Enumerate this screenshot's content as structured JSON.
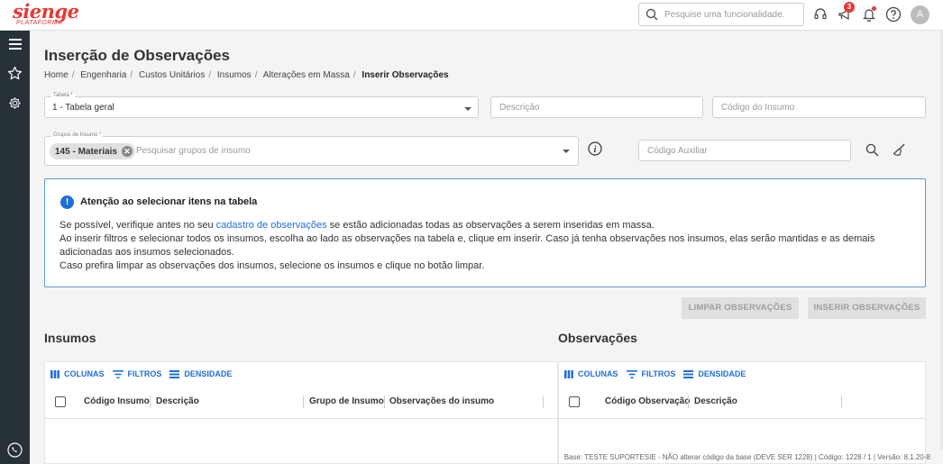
{
  "brand": {
    "name": "sienge",
    "sub": "PLATAFORMA",
    "color": "#e53935"
  },
  "header": {
    "search_placeholder": "Pesquise uma funcionalidade.",
    "notification_count": "3",
    "avatar_letter": "A",
    "icons": [
      "search-icon",
      "headset-icon",
      "megaphone-icon",
      "bell-icon",
      "help-icon"
    ]
  },
  "sidebar": {
    "icons": [
      "menu-icon",
      "star-icon",
      "gear-icon",
      "phone-icon"
    ]
  },
  "page": {
    "title": "Inserção de Observações",
    "breadcrumb": [
      "Home",
      "Engenharia",
      "Custos Unitários",
      "Insumos",
      "Alterações em Massa",
      "Inserir Observações"
    ]
  },
  "filters": {
    "tabela_label": "Tabela *",
    "tabela_value": "1 - Tabela geral",
    "descricao_placeholder": "Descrição",
    "codigo_insumo_placeholder": "Código do Insumo",
    "grupos_label": "Grupos de Insumo *",
    "grupos_chip": "145 - Materiais",
    "grupos_placeholder": "Pesquisar grupos de insumo",
    "codigo_auxiliar_placeholder": "Código Auxiliar"
  },
  "alert": {
    "title": "Atenção ao selecionar itens na tabela",
    "line1_before": "Se possível, verifique antes no seu ",
    "line1_link": "cadastro de observações",
    "line1_after": " se estão adicionadas todas as observações a serem inseridas em massa.",
    "line2": "Ao inserir filtros e selecionar todos os insumos, escolha ao lado as observações na tabela e, clique em inserir. Caso já tenha observações nos insumos, elas serão mantidas e as demais adicionadas aos insumos selecionados.",
    "line3": "Caso prefira limpar as observações dos insumos, selecione os insumos e clique no botão limpar."
  },
  "actions": {
    "limpar": "LIMPAR OBSERVAÇÕES",
    "inserir": "INSERIR OBSERVAÇÕES"
  },
  "insumos": {
    "title": "Insumos",
    "toolbar": {
      "colunas": "COLUNAS",
      "filtros": "FILTROS",
      "densidade": "DENSIDADE"
    },
    "columns": [
      "Código Insumo",
      "Descrição",
      "Grupo de Insumo",
      "Observações do insumo"
    ]
  },
  "observacoes": {
    "title": "Observações",
    "toolbar": {
      "colunas": "COLUNAS",
      "filtros": "FILTROS",
      "densidade": "DENSIDADE"
    },
    "columns": [
      "Código Observação",
      "Descrição"
    ]
  },
  "footer": "Base: TESTE SUPORTESIE - NÃO alterar código da base (DEVE SER 1228) | Código: 1228 / 1 | Versão: 8.1.20-8",
  "colors": {
    "accent": "#1e6fd9",
    "sidebar": "#263238",
    "disabled_button": "#e0e0e0"
  }
}
